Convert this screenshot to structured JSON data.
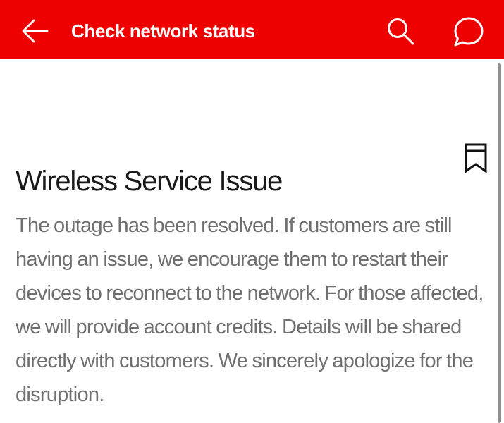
{
  "header": {
    "title": "Check network status",
    "background_color": "#ee0000",
    "back_icon": "arrow-left-icon",
    "search_icon": "search-icon",
    "chat_icon": "chat-bubble-icon"
  },
  "article": {
    "title": "Wireless Service Issue",
    "body": "The outage has been resolved. If customers are still having an issue, we encourage them to restart their devices to reconnect to the network. For those affected, we will provide account credits. Details will be shared directly with customers. We sincerely apologize for the disruption.",
    "bookmark_icon": "bookmark-icon",
    "title_color": "#1a1a1a",
    "body_color": "#6f6f6f"
  }
}
